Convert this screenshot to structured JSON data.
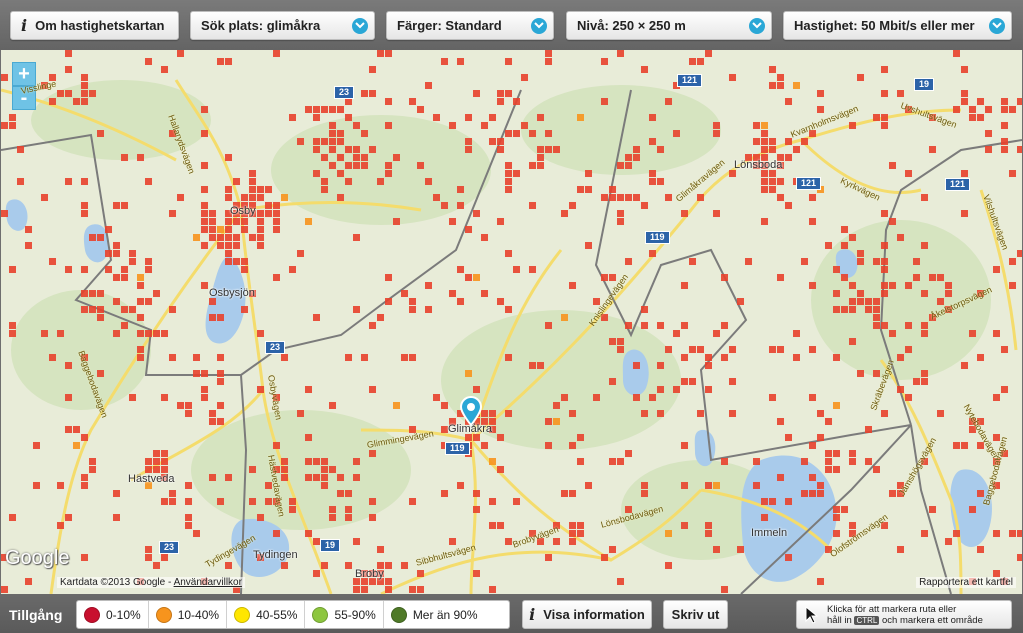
{
  "toolbar": {
    "about_label": "Om hastighetskartan",
    "search_label": "Sök plats: glimåkra",
    "colors_label": "Färger: Standard",
    "level_label": "Nivå: 250 × 250 m",
    "speed_label": "Hastighet: 50 Mbit/s eller mer"
  },
  "map": {
    "zoom_in": "+",
    "zoom_out": "-",
    "places": {
      "osby": "Osby",
      "osbysjon": "Osbysjön",
      "glimakra": "Glimåkra",
      "hastveda": "Hästveda",
      "broby": "Broby",
      "lonsboda": "Lönsboda",
      "immeln": "Immeln",
      "tydingen": "Tydingen"
    },
    "roads": {
      "hallaryd": "Hallarydsvägen",
      "visslinge": "Visslinge",
      "bagge": "Baggebodavägen",
      "osbyvagen": "Osbyvägen",
      "glimminge": "Glimmingevägen",
      "broby": "Brobyvägen",
      "lonsbo": "Lönsbodavägen",
      "glimakrav": "Glimåkravägen",
      "knislinge": "Knislingevägen",
      "kvarnh": "Kvarnholmsvägen",
      "uvshult": "Uvshultsvägen",
      "kyrk": "Kyrkvägen",
      "akelsto": "Åkelstorpsvägen",
      "nytebo": "Nytebodavägen",
      "skrabe": "Skräbevägen",
      "olofs": "Olofströmsvägen",
      "sibbhult": "Sibbhultsvägen",
      "tydinge": "Tydingevägen",
      "bagge2": "Baggebodavägen",
      "vilshult": "Vilshultsvägen",
      "hastvedav": "Hästvedavägen",
      "jamsh": "Jämshögsvägen"
    },
    "shields": {
      "s1": "23",
      "s2": "121",
      "s3": "121",
      "s4": "119",
      "s5": "23",
      "s6": "119",
      "s7": "19",
      "s8": "23",
      "s9": "121",
      "s10": "19"
    },
    "google_logo": "Google",
    "attribution": "Kartdata ©2013 Google - ",
    "terms_link": "Användarvillkor",
    "report_link": "Rapportera ett kartfel"
  },
  "legend": {
    "title": "Tillgång",
    "items": [
      {
        "label": "0-10%",
        "color": "#c8102e"
      },
      {
        "label": "10-40%",
        "color": "#f7941d"
      },
      {
        "label": "40-55%",
        "color": "#ffe600"
      },
      {
        "label": "55-90%",
        "color": "#8dc63f"
      },
      {
        "label": "Mer än 90%",
        "color": "#4f7a28"
      }
    ]
  },
  "bottombar": {
    "info_label": "Visa information",
    "print_label": "Skriv ut",
    "hint_line1": "Klicka för att markera ruta eller",
    "hint_line2_pre": "håll in",
    "hint_key": "CTRL",
    "hint_line2_post": "och markera ett område"
  },
  "colors": {
    "coverage_primary": "#e8412c",
    "coverage_secondary": "#f7941d",
    "water": "#a9cbeb",
    "land": "#e8ecd8",
    "forest": "#d4e3bd",
    "road": "#f6e27a",
    "border": "#7b7b7b"
  }
}
